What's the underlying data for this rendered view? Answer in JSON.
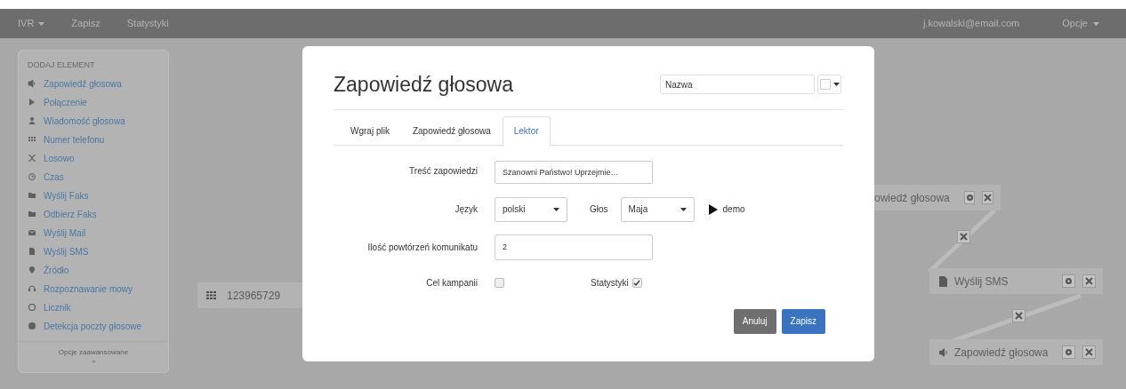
{
  "navbar": {
    "items": [
      {
        "label": "IVR",
        "caret": true
      },
      {
        "label": "Zapisz",
        "caret": false
      },
      {
        "label": "Statystyki",
        "caret": false
      }
    ],
    "user": "j.kowalski@email.com",
    "options": {
      "label": "Opcje",
      "caret": true
    }
  },
  "sidebar": {
    "heading": "DODAJ ELEMENT",
    "items": [
      {
        "label": "Zapowiedź głosowa"
      },
      {
        "label": "Połączenie"
      },
      {
        "label": "Wiadomość głosowa"
      },
      {
        "label": "Numer telefonu"
      },
      {
        "label": "Losowo"
      },
      {
        "label": "Czas"
      },
      {
        "label": "Wyślij Faks"
      },
      {
        "label": "Odbierz Faks"
      },
      {
        "label": "Wyślij Mail"
      },
      {
        "label": "Wyślij SMS"
      },
      {
        "label": "Źródło"
      },
      {
        "label": "Rozpoznawanie mowy"
      },
      {
        "label": "Licznik"
      },
      {
        "label": "Detekcja poczty głosowe"
      }
    ],
    "footer": "Opcje zaawansowane"
  },
  "canvas": {
    "phone_node": {
      "label": "123965729"
    },
    "nodes": [
      {
        "label": "owiedź głosowa",
        "kind": "cut"
      },
      {
        "label": "Wyślij SMS",
        "kind": "sms"
      },
      {
        "label": "Zapowiedź głosowa",
        "kind": "voice"
      }
    ]
  },
  "modal": {
    "title": "Zapowiedź głosowa",
    "name_field": {
      "placeholder": "Nazwa"
    },
    "tabs": [
      {
        "label": "Wgraj plik",
        "selected": false
      },
      {
        "label": "Zapowiedź głosowa",
        "selected": false
      },
      {
        "label": "Lektor",
        "selected": true
      }
    ],
    "message": {
      "label": "Treść zapowiedzi",
      "value": "Szanowni Państwo! Uprzejmie…"
    },
    "language": {
      "label": "Język",
      "value": "polski"
    },
    "voice": {
      "label": "Głos",
      "value": "Maja"
    },
    "demo": "demo",
    "repeats": {
      "label": "Ilość powtórzeń komunikatu",
      "value": "2"
    },
    "checkboxes": [
      {
        "label": "Cel kampanii",
        "checked": false
      },
      {
        "label": "Statystyki",
        "checked": true
      }
    ],
    "buttons": [
      {
        "label": "Anuluj",
        "kind": "secondary"
      },
      {
        "label": "Zapisz",
        "kind": "primary"
      }
    ]
  }
}
